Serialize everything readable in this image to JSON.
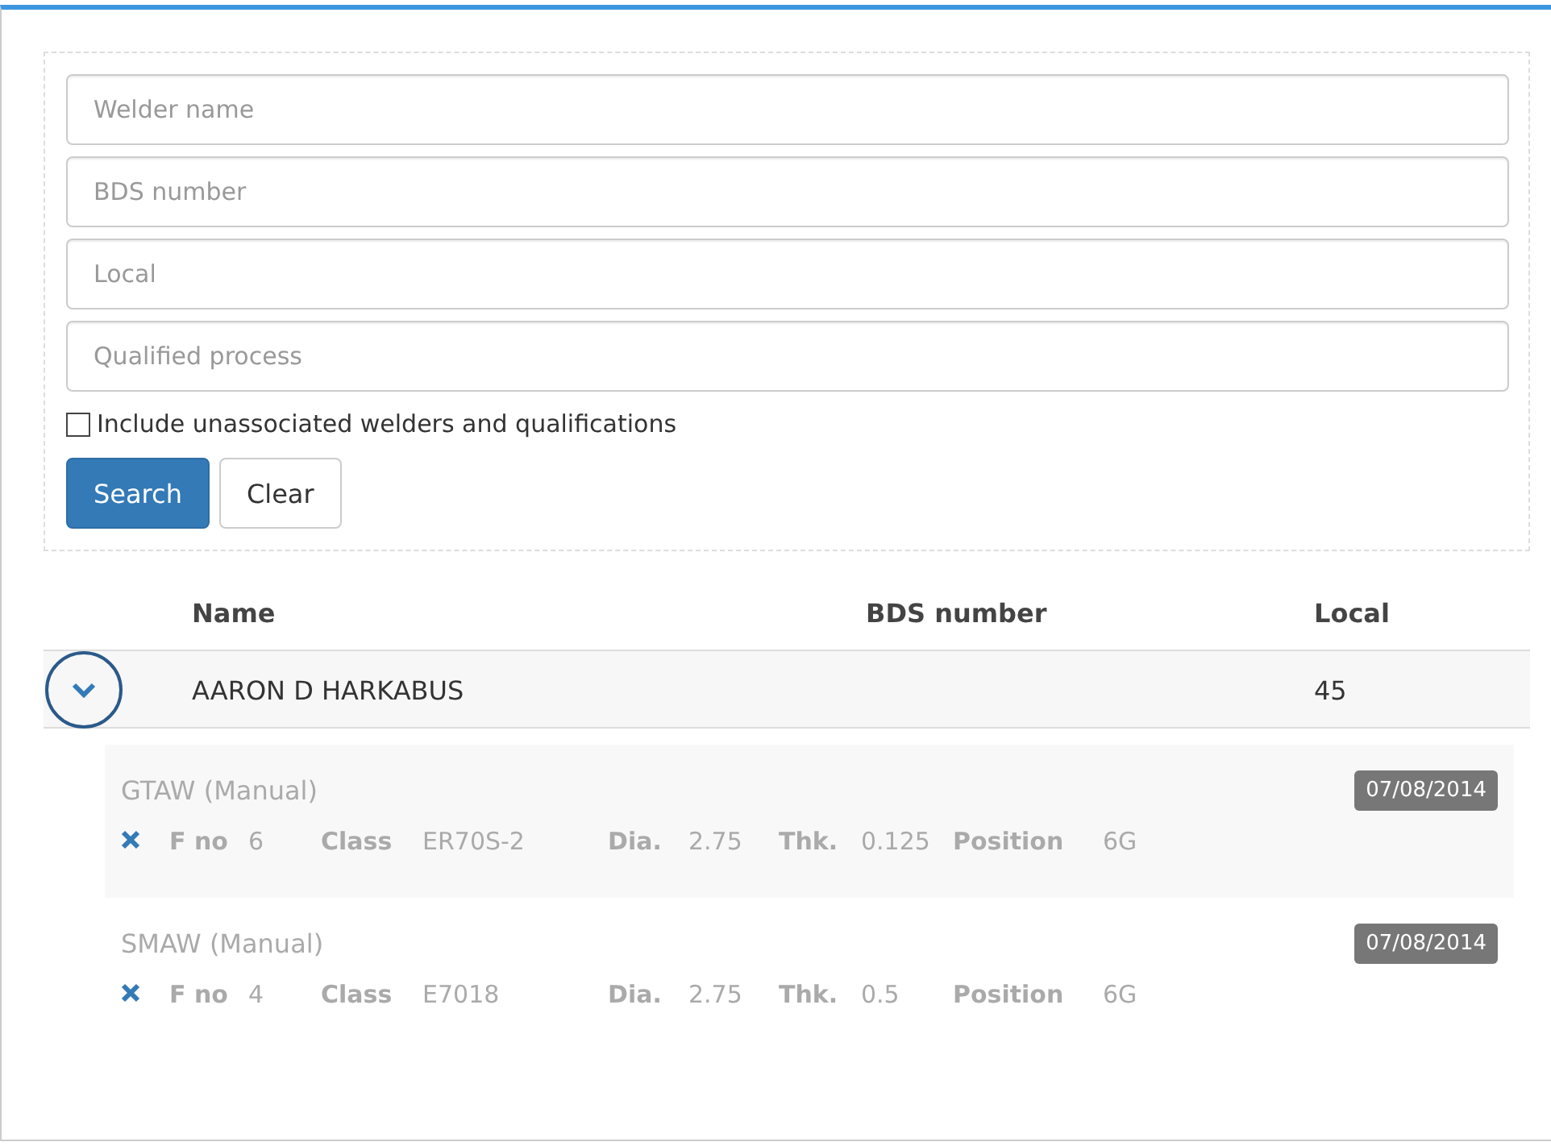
{
  "search_form": {
    "fields": [
      {
        "placeholder": "Welder name"
      },
      {
        "placeholder": "BDS number"
      },
      {
        "placeholder": "Local"
      },
      {
        "placeholder": "Qualified process"
      }
    ],
    "include_unassociated": {
      "label": "Include unassociated welders and qualifications",
      "checked": false
    },
    "buttons": [
      {
        "label": "Search",
        "kind": "primary"
      },
      {
        "label": "Clear",
        "kind": "default"
      }
    ]
  },
  "results": {
    "columns": [
      "Name",
      "BDS number",
      "Local"
    ],
    "rows": [
      {
        "name": "AARON D HARKABUS",
        "bds_number": "",
        "local": "45",
        "expanded": true,
        "qualifications": [
          {
            "process": "GTAW (Manual)",
            "date": "07/08/2014",
            "details": [
              {
                "label": "F no",
                "value": "6"
              },
              {
                "label": "Class",
                "value": "ER70S-2"
              },
              {
                "label": "Dia.",
                "value": "2.75"
              },
              {
                "label": "Thk.",
                "value": "0.125"
              },
              {
                "label": "Position",
                "value": "6G"
              }
            ]
          },
          {
            "process": "SMAW (Manual)",
            "date": "07/08/2014",
            "details": [
              {
                "label": "F no",
                "value": "4"
              },
              {
                "label": "Class",
                "value": "E7018"
              },
              {
                "label": "Dia.",
                "value": "2.75"
              },
              {
                "label": "Thk.",
                "value": "0.5"
              },
              {
                "label": "Position",
                "value": "6G"
              }
            ]
          }
        ]
      }
    ]
  }
}
